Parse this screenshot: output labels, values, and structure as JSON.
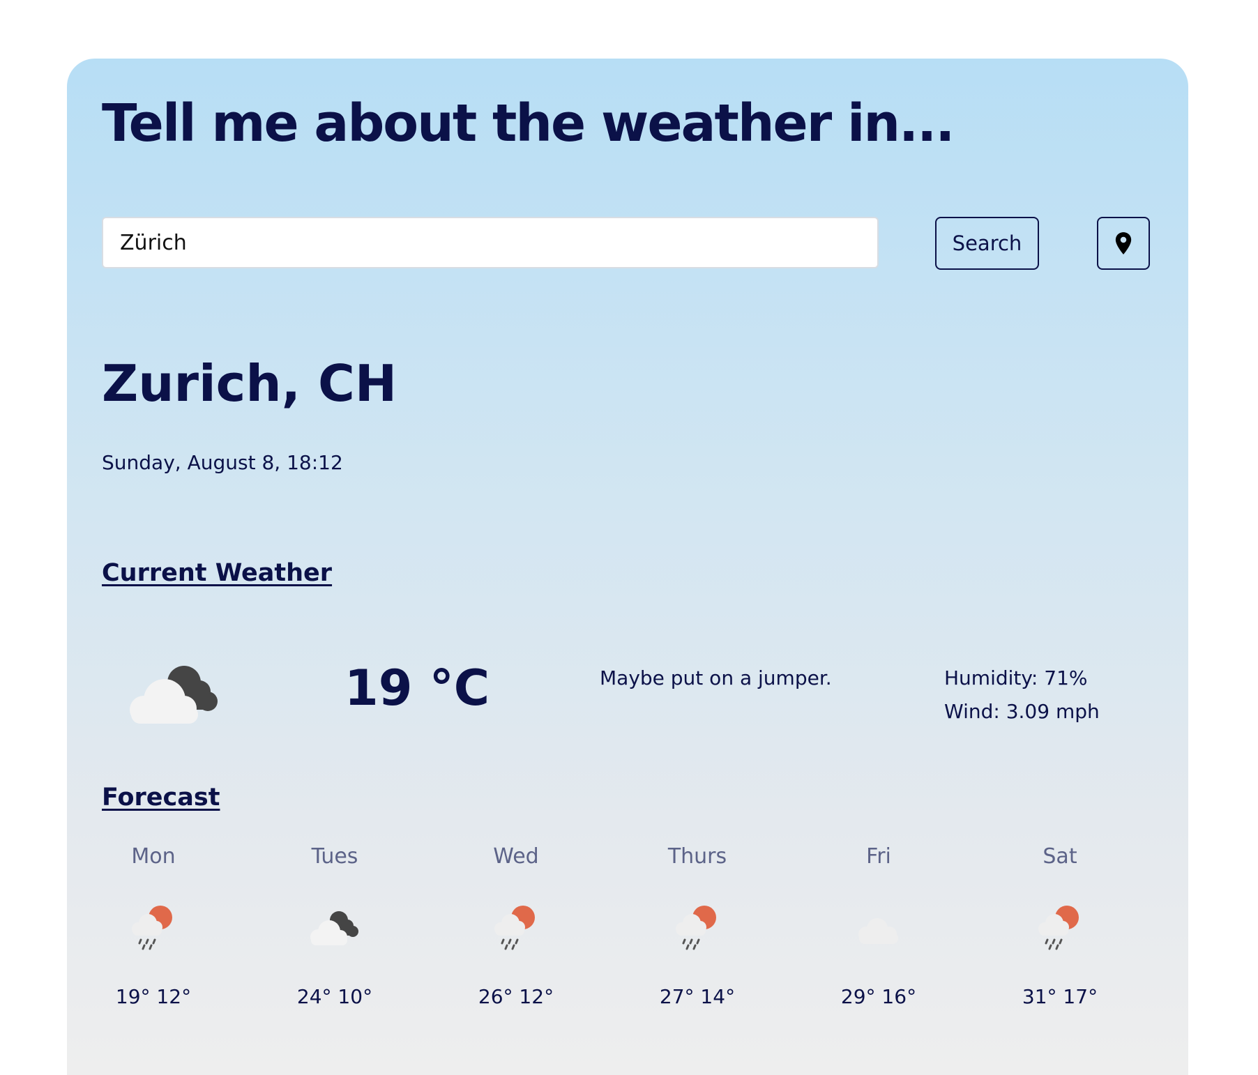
{
  "header": {
    "title": "Tell me about the weather in..."
  },
  "search": {
    "value": "Zürich",
    "button_label": "Search",
    "location_icon": "map-pin-icon"
  },
  "location": {
    "city": "Zurich, CH",
    "datetime": "Sunday, August 8, 18:12"
  },
  "current": {
    "section_title": "Current Weather",
    "icon": "cloudy-icon",
    "temperature": "19 °C",
    "advice": "Maybe put on a jumper.",
    "humidity": "Humidity: 71%",
    "wind": "Wind: 3.09 mph"
  },
  "forecast": {
    "section_title": "Forecast",
    "days": [
      {
        "day": "Mon",
        "icon": "rain-sun-icon",
        "temps": "19° 12°"
      },
      {
        "day": "Tues",
        "icon": "cloudy-icon",
        "temps": "24° 10°"
      },
      {
        "day": "Wed",
        "icon": "rain-sun-icon",
        "temps": "26° 12°"
      },
      {
        "day": "Thurs",
        "icon": "rain-sun-icon",
        "temps": "27° 14°"
      },
      {
        "day": "Fri",
        "icon": "cloud-icon",
        "temps": "29° 16°"
      },
      {
        "day": "Sat",
        "icon": "rain-sun-icon",
        "temps": "31° 17°"
      }
    ]
  },
  "colors": {
    "text": "#0b1148",
    "sun": "#e0694a",
    "dark_cloud": "#454545",
    "light_cloud": "#f3f3f3"
  }
}
